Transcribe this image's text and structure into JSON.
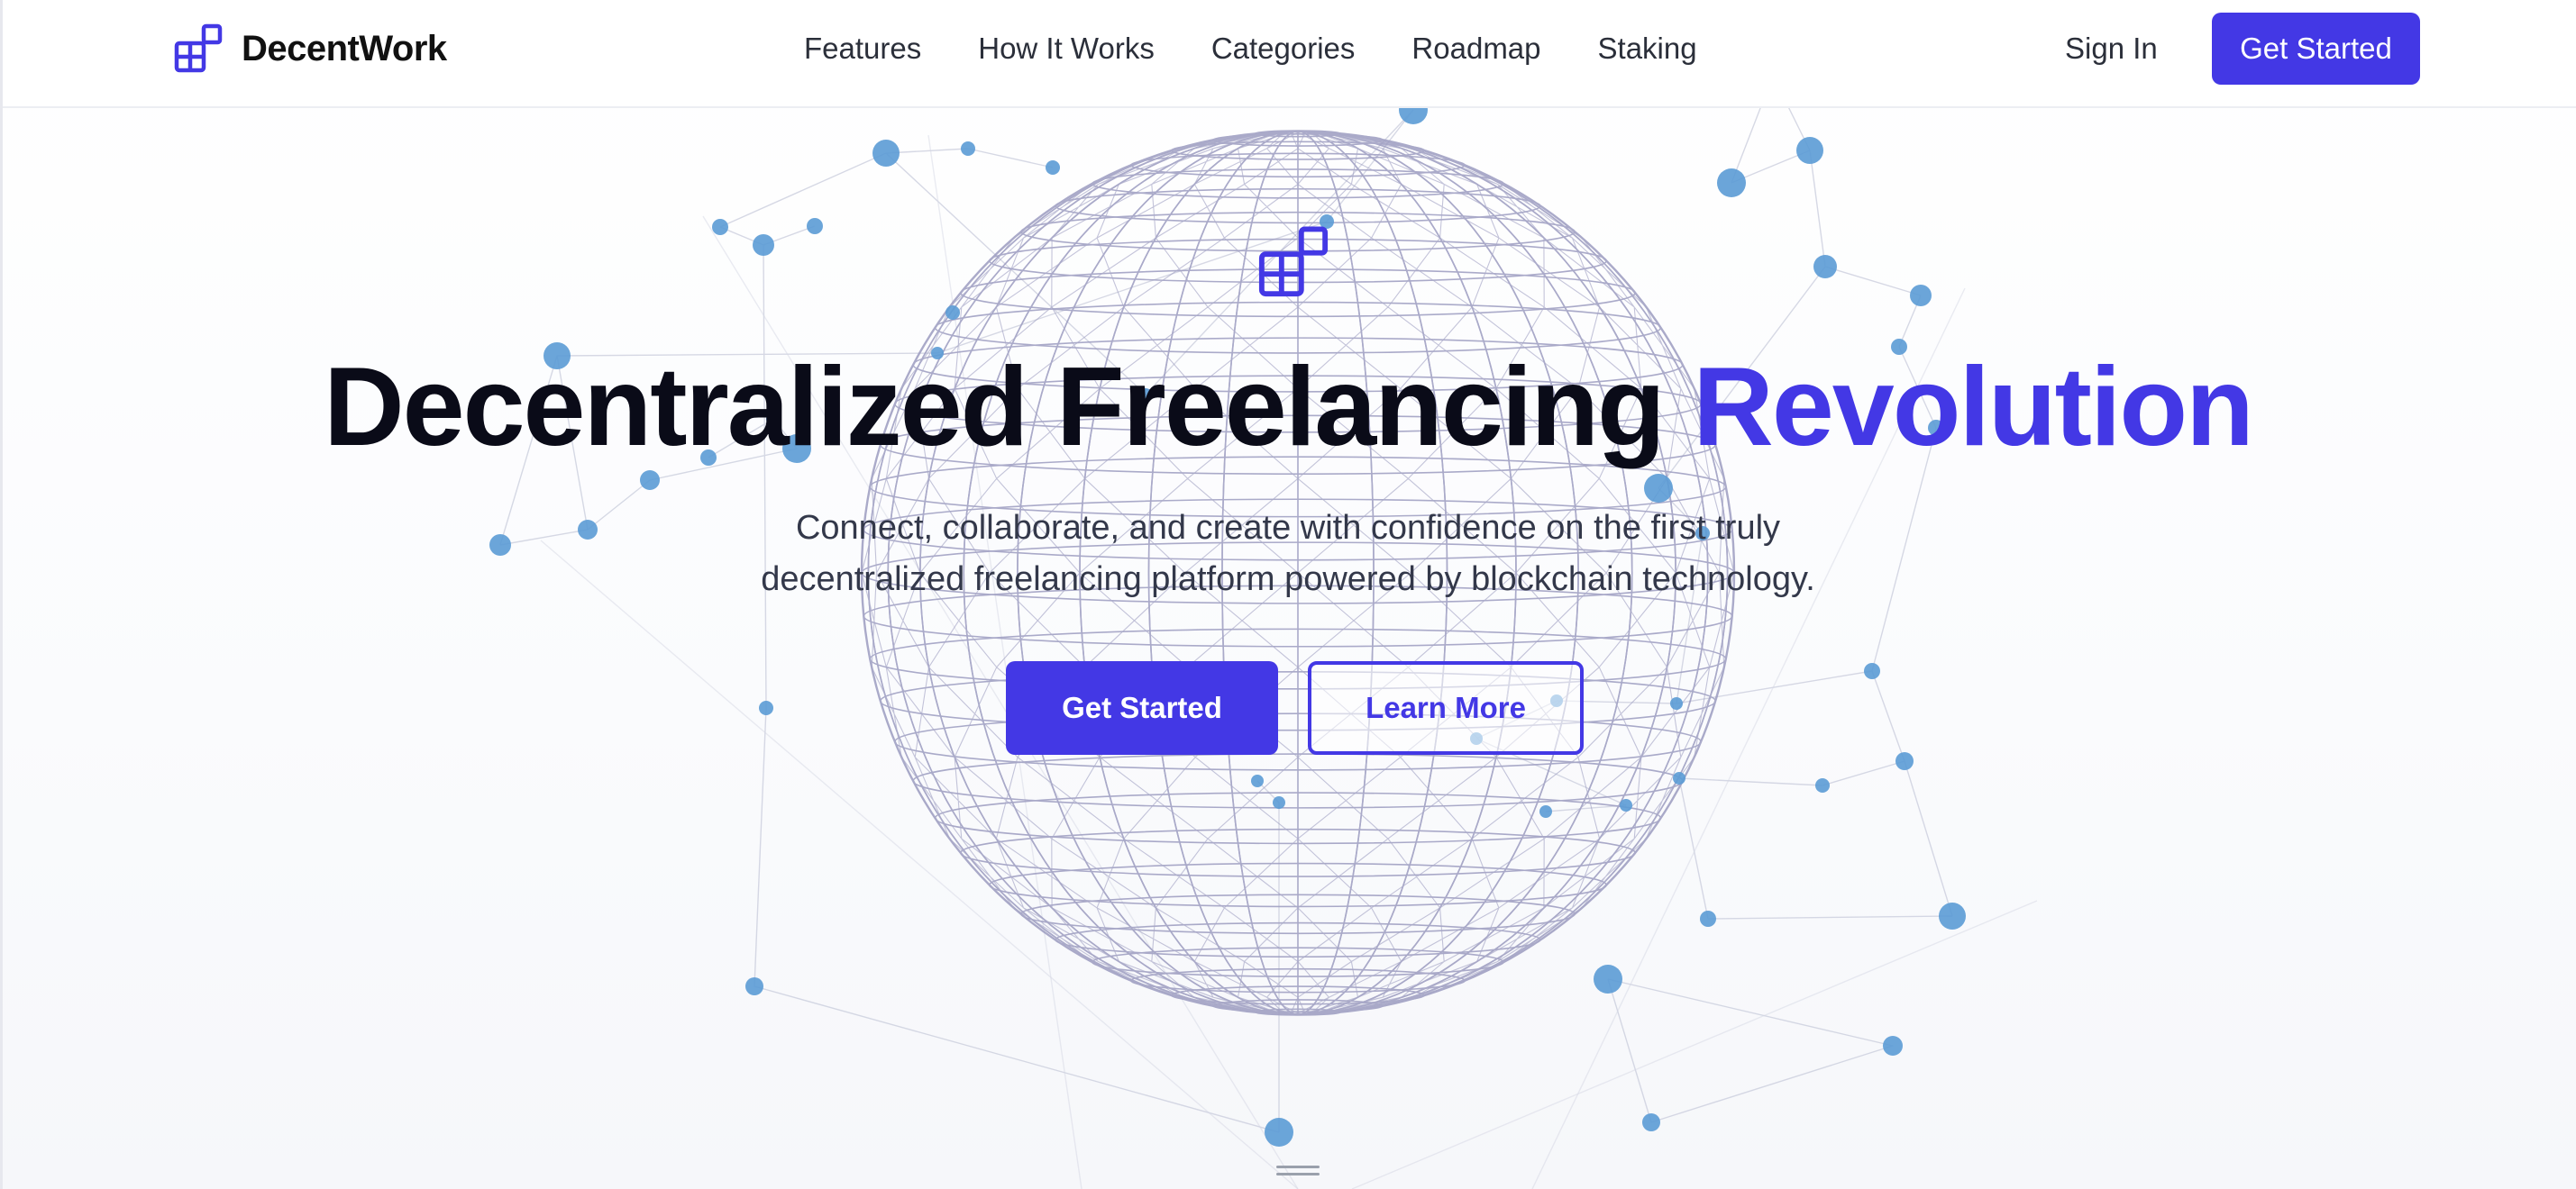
{
  "brand": {
    "name": "DecentWork",
    "icon": "grid-blocks-logo-icon",
    "color": "#4338e5"
  },
  "nav": {
    "links": [
      "Features",
      "How It Works",
      "Categories",
      "Roadmap",
      "Staking"
    ],
    "sign_in": "Sign In",
    "cta": "Get Started"
  },
  "hero": {
    "logo_icon": "grid-blocks-logo-icon",
    "title_main": "Decentralized Freelancing ",
    "title_accent": "Revolution",
    "subtitle_line1": "Connect, collaborate, and create with confidence on the first truly",
    "subtitle_line2": "decentralized freelancing platform powered by blockchain technology.",
    "primary_button": "Get Started",
    "secondary_button": "Learn More",
    "background": "wireframe-globe-network-graphic",
    "accent_color": "#4338e5",
    "node_color": "#5b9bd5",
    "scroll_icon": "scroll-down-handle-icon"
  }
}
